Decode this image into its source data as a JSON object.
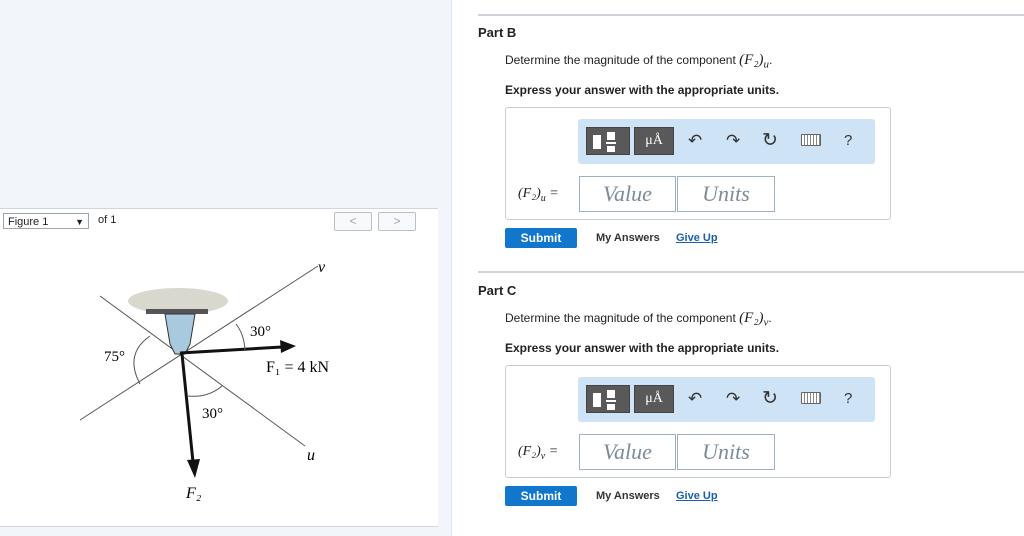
{
  "figure": {
    "select_label": "Figure 1",
    "of_label": "of 1",
    "prev": "<",
    "next": ">",
    "labels": {
      "v": "v",
      "u": "u",
      "angle_top": "30°",
      "angle_left": "75°",
      "angle_bottom": "30°",
      "f1": "F₁ = 4 kN",
      "f2": "F₂"
    }
  },
  "parts": [
    {
      "title": "Part B",
      "question": "Determine the magnitude of the component",
      "component": "(F₂)",
      "subscript": "u",
      "instruction": "Express your answer with the appropriate units.",
      "eq_label": "(F₂)",
      "eq_sub": "u",
      "value_placeholder": "Value",
      "units_placeholder": "Units",
      "submit": "Submit",
      "my_answers": "My Answers",
      "give_up": "Give Up"
    },
    {
      "title": "Part C",
      "question": "Determine the magnitude of the component",
      "component": "(F₂)",
      "subscript": "v",
      "instruction": "Express your answer with the appropriate units.",
      "eq_label": "(F₂)",
      "eq_sub": "v",
      "value_placeholder": "Value",
      "units_placeholder": "Units",
      "submit": "Submit",
      "my_answers": "My Answers",
      "give_up": "Give Up"
    }
  ],
  "toolbar": {
    "units_glyph": "μÅ",
    "undo_icon": "undo-icon",
    "redo_icon": "redo-icon",
    "reset_icon": "reset-icon",
    "keyboard_icon": "keyboard-icon",
    "help": "?"
  },
  "colors": {
    "submit": "#1177cc",
    "toolbar_bg": "#cfe3f6",
    "link": "#1a5fa8",
    "bracket": "#a9c9df"
  }
}
